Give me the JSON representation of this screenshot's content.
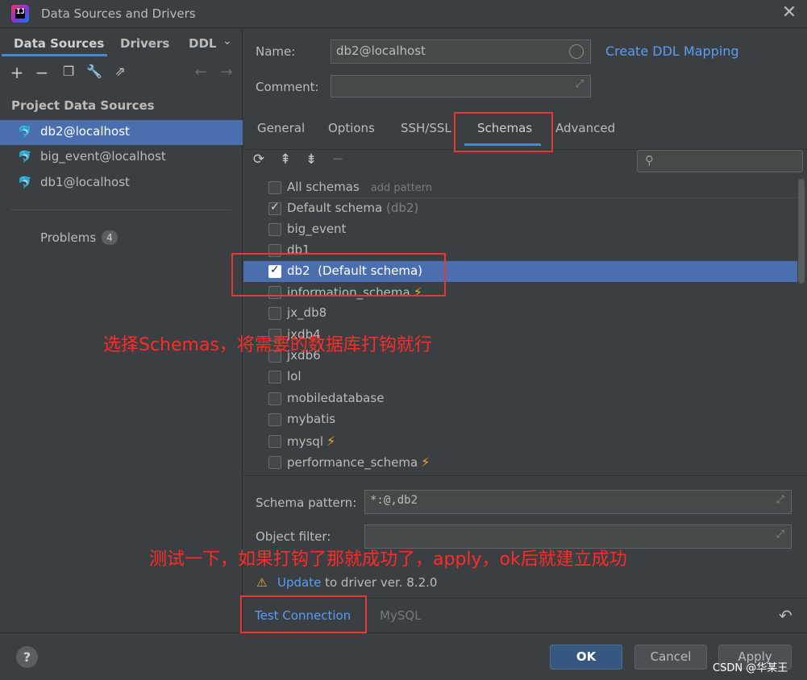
{
  "window": {
    "title": "Data Sources and Drivers",
    "app_icon_text": "IJ"
  },
  "left": {
    "tabs": [
      "Data Sources",
      "Drivers",
      "DDL"
    ],
    "section_label": "Project Data Sources",
    "items": [
      {
        "label": "db2@localhost",
        "selected": true
      },
      {
        "label": "big_event@localhost",
        "selected": false
      },
      {
        "label": "db1@localhost",
        "selected": false
      }
    ],
    "problems_label": "Problems",
    "problems_count": "4"
  },
  "form": {
    "name_label": "Name:",
    "name_value": "db2@localhost",
    "comment_label": "Comment:",
    "comment_value": "",
    "ddl_link": "Create DDL Mapping"
  },
  "tabs": [
    "General",
    "Options",
    "SSH/SSL",
    "Schemas",
    "Advanced"
  ],
  "active_tab": "Schemas",
  "schemas": {
    "header": {
      "label": "All schemas",
      "hint": "add pattern"
    },
    "items": [
      {
        "name": "Default schema",
        "sub": "(db2)",
        "checked": true
      },
      {
        "name": "big_event",
        "checked": false
      },
      {
        "name": "db1",
        "checked": false
      },
      {
        "name": "db2",
        "sub": "(Default schema)",
        "checked": true,
        "selected": true
      },
      {
        "name": "information_schema",
        "checked": false,
        "bolt": true
      },
      {
        "name": "jx_db8",
        "checked": false
      },
      {
        "name": "jxdb4",
        "checked": false
      },
      {
        "name": "jxdb6",
        "checked": false
      },
      {
        "name": "lol",
        "checked": false
      },
      {
        "name": "mobiledatabase",
        "checked": false
      },
      {
        "name": "mybatis",
        "checked": false
      },
      {
        "name": "mysql",
        "checked": false,
        "bolt": true
      },
      {
        "name": "performance_schema",
        "checked": false,
        "bolt": true
      }
    ]
  },
  "patterns": {
    "schema_label": "Schema pattern:",
    "schema_value": "*:@,db2",
    "object_label": "Object filter:",
    "object_value": ""
  },
  "update_notice": {
    "link": "Update",
    "text": "to driver ver. 8.2.0"
  },
  "bottom_tabs": [
    "Test Connection",
    "MySQL"
  ],
  "buttons": {
    "ok": "OK",
    "cancel": "Cancel",
    "apply": "Apply",
    "help": "?"
  },
  "annotations": {
    "text1": "选择Schemas，将需要的数据库打钩就行",
    "text2": "测试一下，如果打钩了那就成功了，apply，ok后就建立成功"
  },
  "watermark": "CSDN @华某王",
  "colors": {
    "accent": "#4a88c7",
    "selection": "#4b6eaf",
    "link": "#589df6",
    "annotation": "#e53935"
  }
}
